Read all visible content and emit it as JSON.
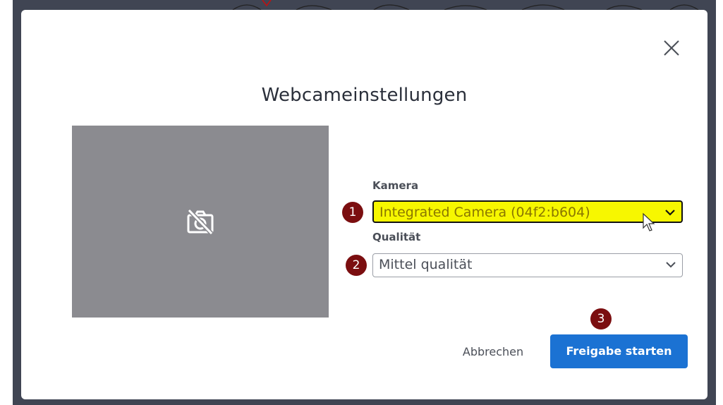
{
  "dialog": {
    "title": "Webcameinstellungen",
    "close_icon": "close-icon"
  },
  "preview": {
    "icon": "camera-off-icon"
  },
  "camera": {
    "label": "Kamera",
    "selected": "Integrated Camera (04f2:b604)"
  },
  "quality": {
    "label": "Qualität",
    "selected": "Mittel qualität"
  },
  "badges": [
    "1",
    "2",
    "3"
  ],
  "buttons": {
    "cancel": "Abbrechen",
    "start": "Freigabe starten"
  },
  "colors": {
    "primary": "#1b72d3",
    "highlight": "#f7f700",
    "badge": "#7b0e10",
    "preview_bg": "#8b8b90"
  }
}
